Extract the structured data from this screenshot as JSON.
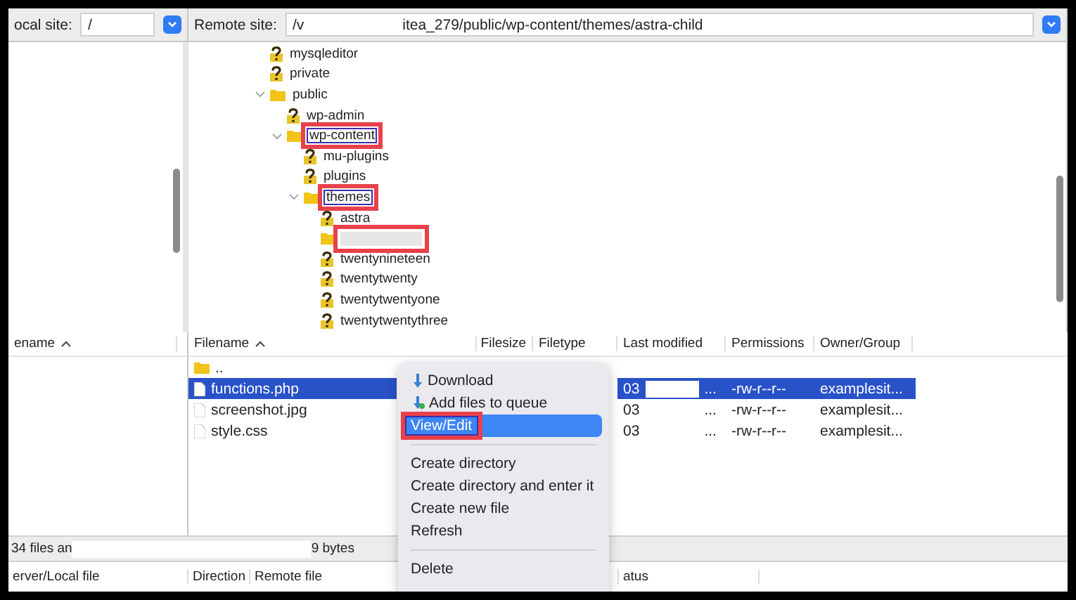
{
  "local_site": {
    "label": "ocal site:",
    "value": "/"
  },
  "remote_site": {
    "label": "Remote site:",
    "value_start": "/v",
    "value_end": "itea_279/public/wp-content/themes/astra-child"
  },
  "remote_tree": [
    {
      "name": "mysqleditor",
      "kind": "unknown",
      "highlighted": false
    },
    {
      "name": "private",
      "kind": "unknown",
      "highlighted": false
    },
    {
      "name": "public",
      "kind": "folder",
      "expanded": true,
      "highlighted": false,
      "children": [
        {
          "name": "wp-admin",
          "kind": "unknown",
          "highlighted": false
        },
        {
          "name": "wp-content",
          "kind": "folder",
          "expanded": true,
          "highlighted": true,
          "children": [
            {
              "name": "mu-plugins",
              "kind": "unknown",
              "highlighted": false
            },
            {
              "name": "plugins",
              "kind": "unknown",
              "highlighted": false
            },
            {
              "name": "themes",
              "kind": "folder",
              "expanded": true,
              "highlighted": true,
              "children": [
                {
                  "name": "astra",
                  "kind": "unknown",
                  "highlighted": false
                },
                {
                  "kind": "redacted",
                  "highlighted": true
                },
                {
                  "name": "twentynineteen",
                  "kind": "unknown",
                  "highlighted": false
                },
                {
                  "name": "twentytwenty",
                  "kind": "unknown",
                  "highlighted": false
                },
                {
                  "name": "twentytwentyone",
                  "kind": "unknown",
                  "highlighted": false
                },
                {
                  "name": "twentytwentythree",
                  "kind": "unknown",
                  "highlighted": false
                }
              ]
            }
          ]
        }
      ]
    }
  ],
  "local_list": {
    "column": "ename"
  },
  "remote_list": {
    "columns": [
      "Filename",
      "Filesize",
      "Filetype",
      "Last modified",
      "Permissions",
      "Owner/Group"
    ],
    "rows": [
      {
        "kind": "folder",
        "name": "..",
        "selected": false
      },
      {
        "kind": "file",
        "name": "functions.php",
        "last_modified": "03",
        "last_modified_end": "...",
        "permissions": "-rw-r--r--",
        "owner": "examplesit...",
        "selected": true
      },
      {
        "kind": "file",
        "name": "screenshot.jpg",
        "last_modified": "03",
        "last_modified_end": "...",
        "permissions": "-rw-r--r--",
        "owner": "examplesit...",
        "selected": false
      },
      {
        "kind": "file",
        "name": "style.css",
        "last_modified": "03",
        "last_modified_end": "...",
        "permissions": "-rw-r--r--",
        "owner": "examplesit...",
        "selected": false
      }
    ]
  },
  "local_status": {
    "start": "34 files an",
    "end": "9 bytes"
  },
  "queue_columns": [
    "erver/Local file",
    "Direction",
    "Remote file",
    "atus"
  ],
  "context_menu": [
    {
      "kind": "download",
      "label": "Download",
      "selected": false,
      "highlighted": false
    },
    {
      "kind": "queue",
      "label": "Add files to queue",
      "selected": false,
      "highlighted": false
    },
    {
      "kind": "item",
      "label": "View/Edit",
      "selected": true,
      "highlighted": true
    },
    {
      "kind": "separator"
    },
    {
      "kind": "item",
      "label": "Create directory",
      "selected": false,
      "highlighted": false
    },
    {
      "kind": "item",
      "label": "Create directory and enter it",
      "selected": false,
      "highlighted": false
    },
    {
      "kind": "item",
      "label": "Create new file",
      "selected": false,
      "highlighted": false
    },
    {
      "kind": "item",
      "label": "Refresh",
      "selected": false,
      "highlighted": false
    },
    {
      "kind": "separator"
    },
    {
      "kind": "item",
      "label": "Delete",
      "selected": false,
      "highlighted": false
    }
  ]
}
